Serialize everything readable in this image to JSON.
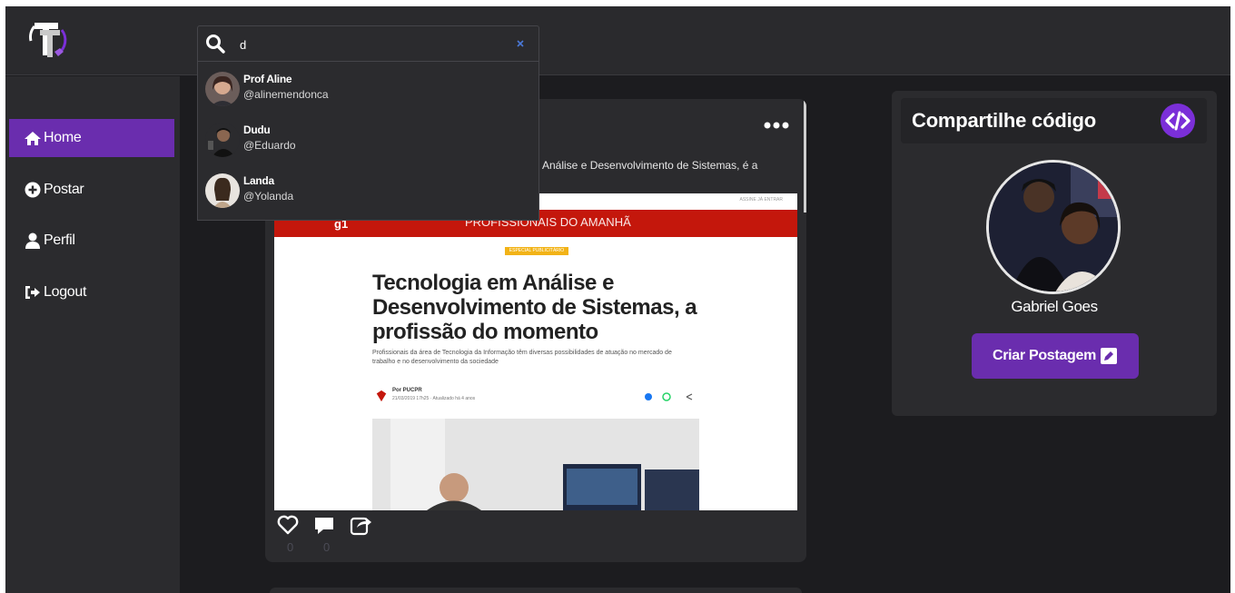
{
  "brand": {
    "logo_icon": "tt-logo-icon",
    "accent": "#6a2dae"
  },
  "search": {
    "value": "d",
    "placeholder": "",
    "clear_icon": "close-icon"
  },
  "search_results": [
    {
      "name": "Prof Aline",
      "handle": "@alinemendonca"
    },
    {
      "name": "Dudu",
      "handle": "@Eduardo"
    },
    {
      "name": "Landa",
      "handle": "@Yolanda"
    }
  ],
  "sidebar": {
    "items": [
      {
        "label": "Home",
        "icon": "home-icon",
        "active": true
      },
      {
        "label": "Postar",
        "icon": "plus-circle-icon",
        "active": false
      },
      {
        "label": "Perfil",
        "icon": "user-icon",
        "active": false
      },
      {
        "label": "Logout",
        "icon": "logout-icon",
        "active": false
      }
    ]
  },
  "post": {
    "text": "Análise e Desenvolvimento de Sistemas, é a",
    "more_icon": "more-icon",
    "image": {
      "banner_logo": "g1",
      "banner_title": "PROFISSIONAIS DO AMANHÃ",
      "tag": "ESPECIAL PUBLICITÁRIO",
      "headline": "Tecnologia em Análise e Desenvolvimento de Sistemas, a profissão do momento",
      "subtitle": "Profissionais da área de Tecnologia da Informação têm diversas possibilidades de atuação no mercado de trabalho e no desenvolvimento da sociedade",
      "author": "Por PUCPR",
      "date": "21/03/2019 17h25 · Atualizado há 4 anos",
      "top_links": "ASSINE JÁ   ENTRAR"
    },
    "likes": "0",
    "comments": "0"
  },
  "profile_panel": {
    "title": "Compartilhe código",
    "title_icon": "code-icon",
    "user_name": "Gabriel Goes",
    "button_label": "Criar Postagem",
    "button_icon": "edit-icon"
  }
}
